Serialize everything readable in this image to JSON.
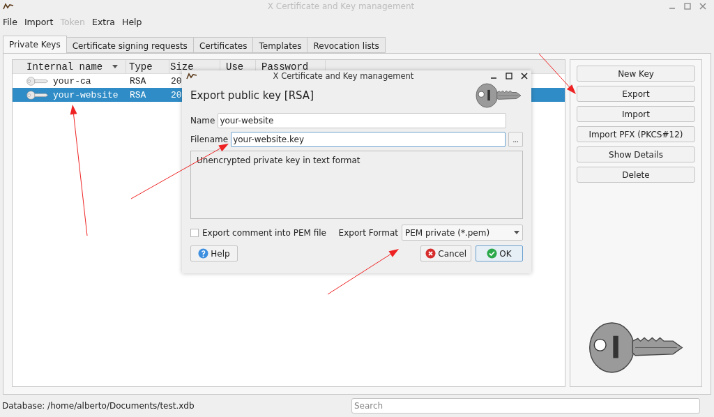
{
  "window": {
    "title": "X Certificate and Key management"
  },
  "menu": [
    {
      "label": "File",
      "disabled": false
    },
    {
      "label": "Import",
      "disabled": false
    },
    {
      "label": "Token",
      "disabled": true
    },
    {
      "label": "Extra",
      "disabled": false
    },
    {
      "label": "Help",
      "disabled": false
    }
  ],
  "tabs": [
    {
      "label": "Private Keys",
      "selected": true
    },
    {
      "label": "Certificate signing requests",
      "selected": false
    },
    {
      "label": "Certificates",
      "selected": false
    },
    {
      "label": "Templates",
      "selected": false
    },
    {
      "label": "Revocation lists",
      "selected": false
    }
  ],
  "table": {
    "columns": [
      {
        "label": "Internal name",
        "sorted": true
      },
      {
        "label": "Type",
        "sorted": false
      },
      {
        "label": "Size",
        "sorted": false
      },
      {
        "label": "Use",
        "sorted": false
      },
      {
        "label": "Password",
        "sorted": false
      }
    ],
    "rows": [
      {
        "cells": [
          "your-ca",
          "RSA",
          "20"
        ],
        "selected": false
      },
      {
        "cells": [
          "your-website",
          "RSA",
          "20"
        ],
        "selected": true
      }
    ]
  },
  "actions": [
    "New Key",
    "Export",
    "Import",
    "Import PFX (PKCS#12)",
    "Show Details",
    "Delete"
  ],
  "status_bar": {
    "database": "Database: /home/alberto/Documents/test.xdb",
    "search_placeholder": "Search"
  },
  "dialog": {
    "title": "X Certificate and Key management",
    "heading": "Export public key [RSA]",
    "name_label": "Name",
    "name_value": "your-website",
    "filename_label": "Filename",
    "filename_value": "your-website.key",
    "browse": "...",
    "description": "Unencrypted private key in text format",
    "comment_checkbox": {
      "label": "Export comment into PEM file",
      "checked": false
    },
    "format_label": "Export Format",
    "format_value": "PEM private (*.pem)",
    "buttons": [
      {
        "label": "Help",
        "kind": "help",
        "default": false
      },
      {
        "label": "Cancel",
        "kind": "cancel",
        "default": false
      },
      {
        "label": "OK",
        "kind": "ok",
        "default": true
      }
    ]
  }
}
